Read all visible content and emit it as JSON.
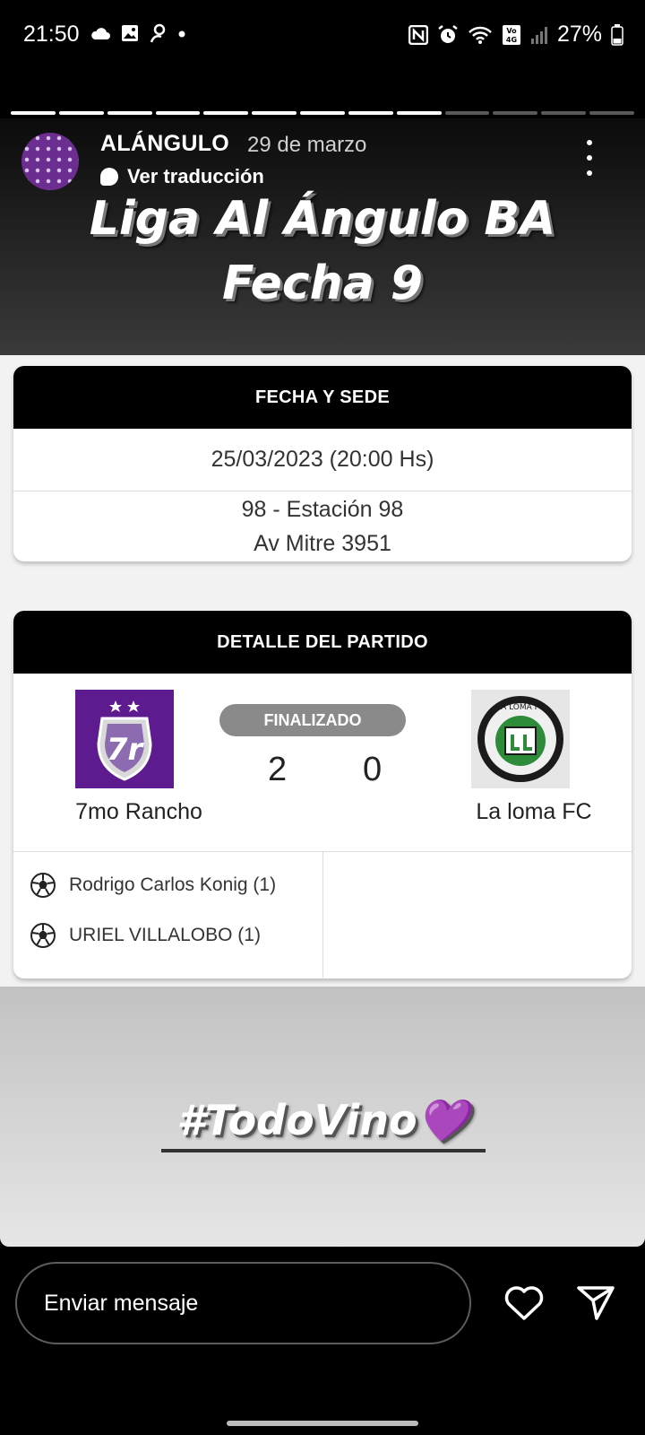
{
  "status_bar": {
    "time": "21:50",
    "battery": "27%",
    "icons": [
      "cloud-icon",
      "gallery-icon",
      "person-pin-icon",
      "dot-icon",
      "nfc-icon",
      "alarm-icon",
      "wifi-icon",
      "volte-icon",
      "signal-icon",
      "battery-icon"
    ]
  },
  "story": {
    "segments_total": 13,
    "segments_done": 9,
    "account": "ALÁNGULO",
    "date": "29 de marzo",
    "translate_label": "Ver traducción",
    "title_line1": "Liga Al Ángulo BA",
    "title_line2": "Fecha 9",
    "hashtag": "#TodoVino💜"
  },
  "venue_card": {
    "header": "FECHA Y SEDE",
    "datetime": "25/03/2023 (20:00 Hs)",
    "venue_name": "98 - Estación 98",
    "venue_address": "Av Mitre 3951"
  },
  "match_card": {
    "header": "DETALLE DEL PARTIDO",
    "status": "FINALIZADO",
    "home_team": "7mo Rancho",
    "away_team": "La loma FC",
    "home_score": "2",
    "away_score": "0",
    "home_scorers": [
      "Rodrigo Carlos Konig (1)",
      "URIEL VILLALOBO (1)"
    ],
    "away_scorers": [],
    "home_crest_color": "#5e1a8f",
    "away_crest_color": "#2e8b3a"
  },
  "reply_bar": {
    "placeholder": "Enviar mensaje",
    "like_icon": "heart-icon",
    "share_icon": "send-icon"
  }
}
